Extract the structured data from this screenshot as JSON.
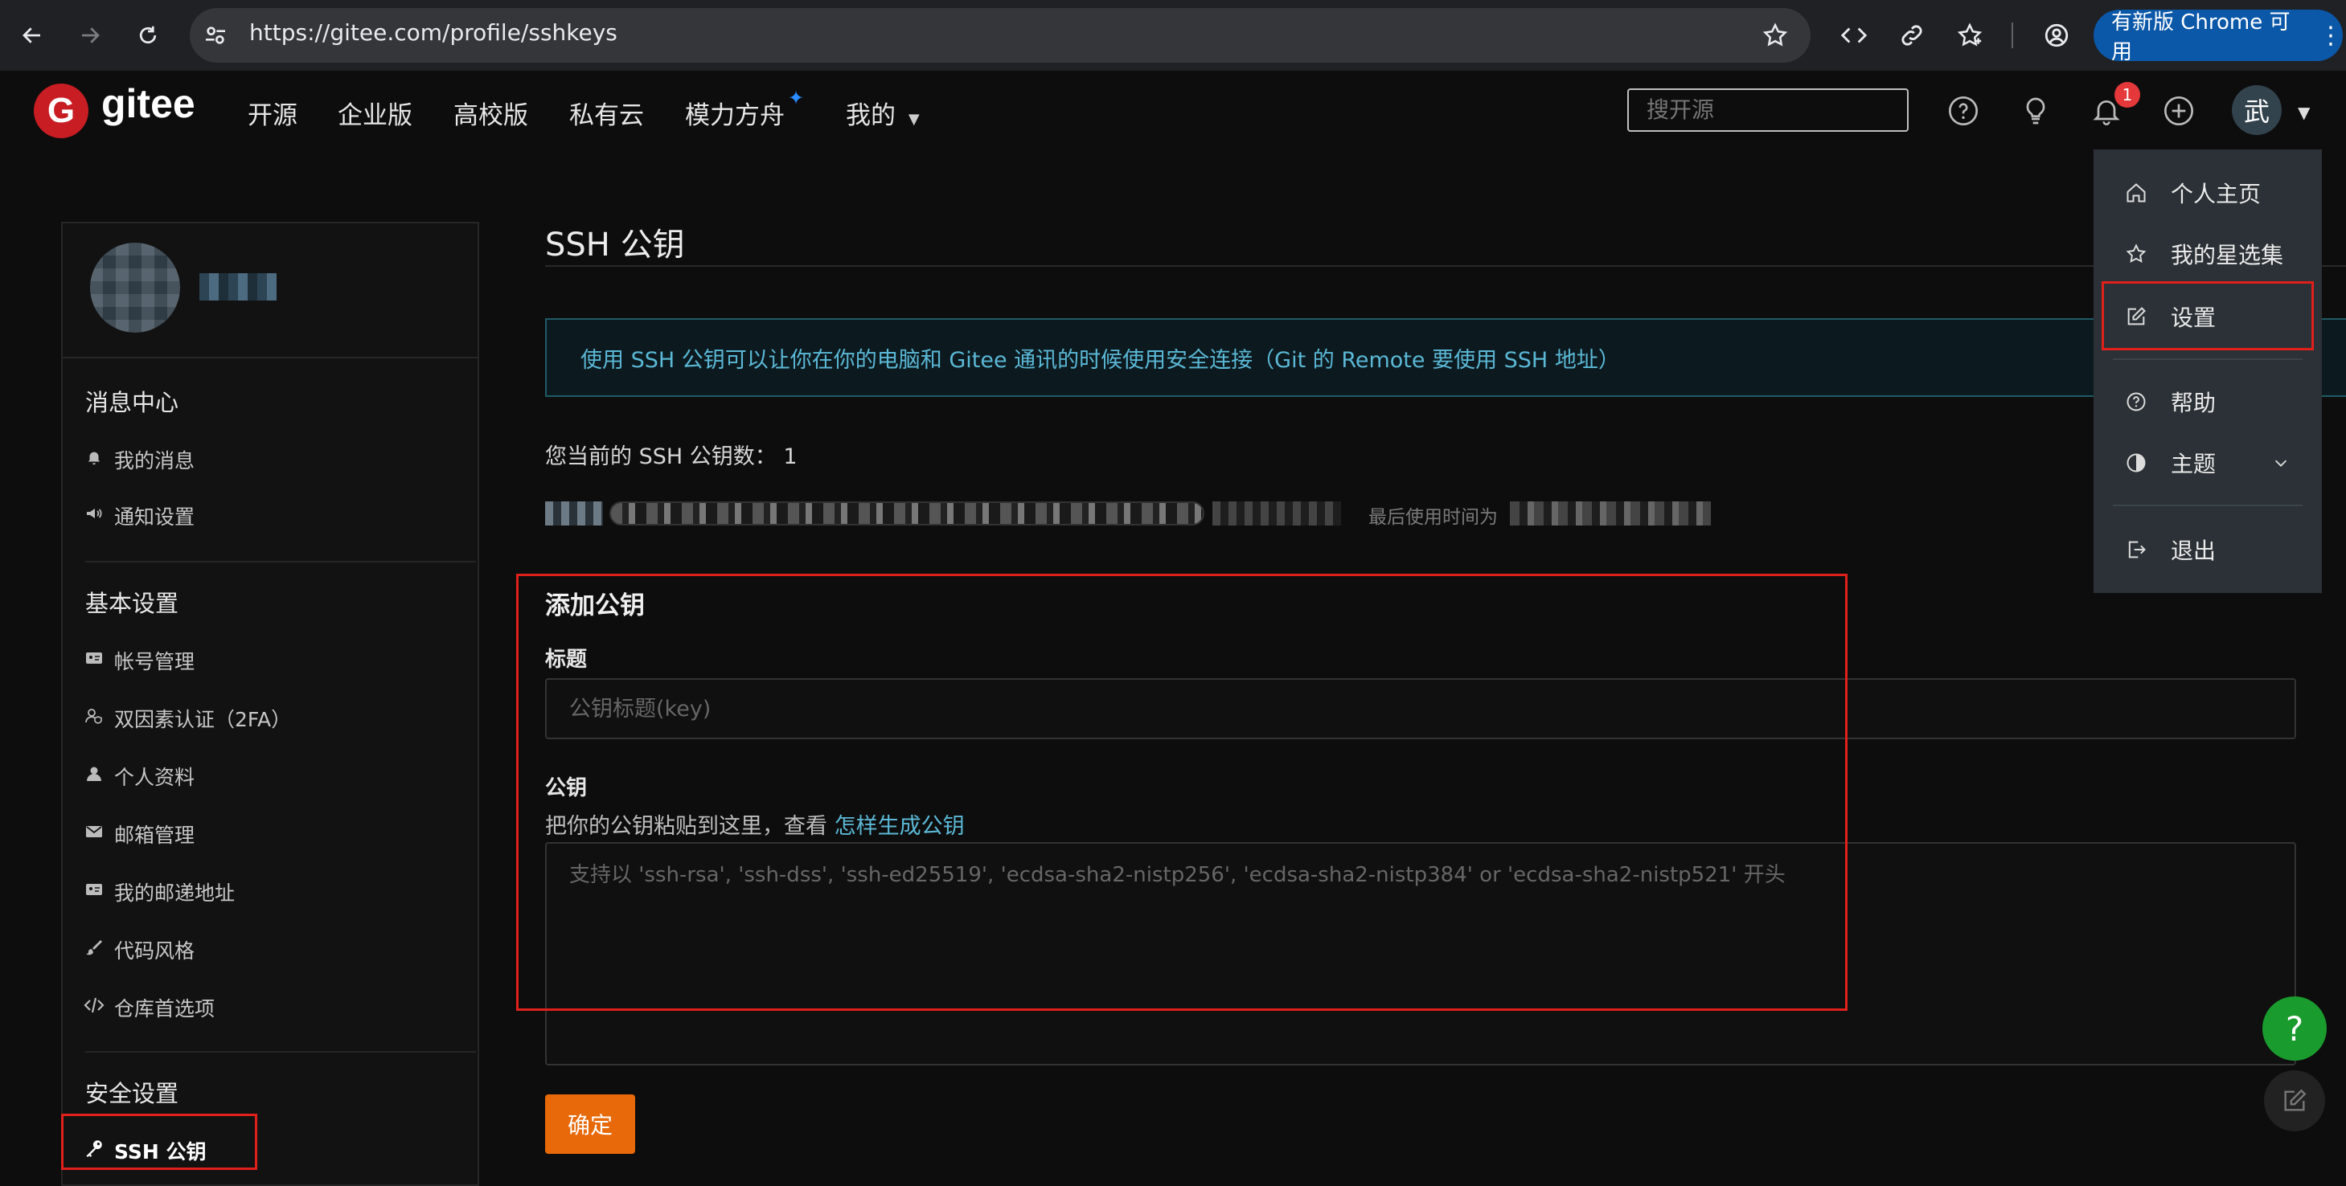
{
  "browser": {
    "url": "https://gitee.com/profile/sshkeys",
    "update_chip": "有新版 Chrome 可用"
  },
  "header": {
    "logo": "gitee",
    "nav": [
      "开源",
      "企业版",
      "高校版",
      "私有云",
      "模力方舟",
      "我的"
    ],
    "search_placeholder": "搜开源",
    "notification_count": "1",
    "avatar_char": "武"
  },
  "user_menu": {
    "items": [
      {
        "label": "个人主页",
        "icon": "home-icon"
      },
      {
        "label": "我的星选集",
        "icon": "star-icon"
      },
      {
        "label": "设置",
        "icon": "edit-icon"
      },
      {
        "label": "帮助",
        "icon": "help-icon"
      },
      {
        "label": "主题",
        "icon": "contrast-icon"
      },
      {
        "label": "退出",
        "icon": "logout-icon"
      }
    ]
  },
  "sidebar": {
    "groups": [
      {
        "title": "消息中心",
        "items": [
          "我的消息",
          "通知设置"
        ]
      },
      {
        "title": "基本设置",
        "items": [
          "帐号管理",
          "双因素认证（2FA）",
          "个人资料",
          "邮箱管理",
          "我的邮递地址",
          "代码风格",
          "仓库首选项"
        ]
      },
      {
        "title": "安全设置",
        "items": [
          "SSH 公钥"
        ]
      }
    ]
  },
  "main": {
    "title": "SSH 公钥",
    "info": "使用 SSH 公钥可以让你在你的电脑和 Gitee 通讯的时候使用安全连接（Git 的 Remote 要使用 SSH 地址）",
    "key_count_label": "您当前的 SSH 公钥数：",
    "key_count": "1",
    "key_meta": "最后使用时间为",
    "add_title": "添加公钥",
    "label_title": "标题",
    "title_placeholder": "公钥标题(key)",
    "label_key": "公钥",
    "hint_prefix": "把你的公钥粘贴到这里，查看 ",
    "hint_link": "怎样生成公钥",
    "key_placeholder": "支持以 'ssh-rsa', 'ssh-dss', 'ssh-ed25519', 'ecdsa-sha2-nistp256', 'ecdsa-sha2-nistp384' or 'ecdsa-sha2-nistp521' 开头",
    "submit": "确定"
  },
  "floating": {
    "help": "?"
  }
}
